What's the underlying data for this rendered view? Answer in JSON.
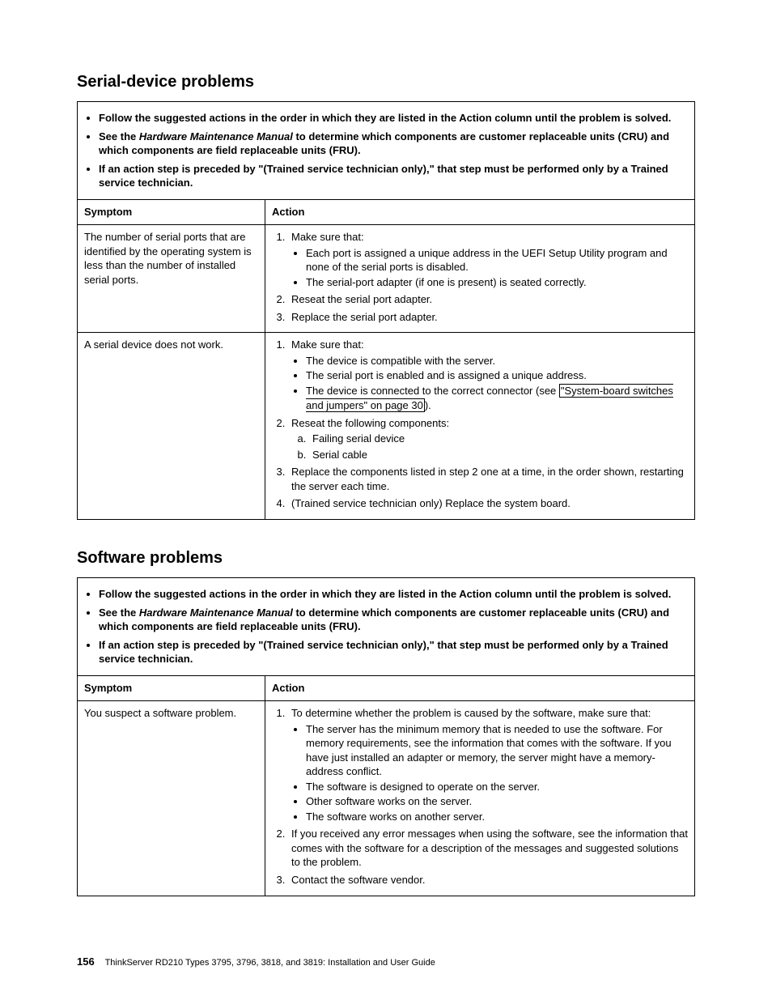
{
  "section1": {
    "title": "Serial-device problems",
    "notice": {
      "n1": "Follow the suggested actions in the order in which they are listed in the Action column until the problem is solved.",
      "n2_pre": "See the ",
      "n2_italic": "Hardware Maintenance Manual",
      "n2_post": " to determine which components are customer replaceable units (CRU) and which components are field replaceable units (FRU).",
      "n3": "If an action step is preceded by \"(Trained service technician only),\" that step must be performed only by a Trained service technician."
    },
    "headers": {
      "symptom": "Symptom",
      "action": "Action"
    },
    "row1": {
      "symptom": "The number of serial ports that are identified by the operating system is less than the number of installed serial ports.",
      "a1": "Make sure that:",
      "a1_b1": "Each port is assigned a unique address in the UEFI Setup Utility program and none of the serial ports is disabled.",
      "a1_b2": "The serial-port adapter (if one is present) is seated correctly.",
      "a2": "Reseat the serial port adapter.",
      "a3": "Replace the serial port adapter."
    },
    "row2": {
      "symptom": "A serial device does not work.",
      "a1": "Make sure that:",
      "a1_b1": "The device is compatible with the server.",
      "a1_b2": "The serial port is enabled and is assigned a unique address.",
      "a1_b3_pre": "The device is connected to the correct connector (see ",
      "a1_b3_link": "\"System-board switches and jumpers\" on page 30",
      "a1_b3_post": ").",
      "a2": "Reseat the following components:",
      "a2_a": "Failing serial device",
      "a2_b": "Serial cable",
      "a3": "Replace the components listed in step 2 one at a time, in the order shown, restarting the server each time.",
      "a4": "(Trained service technician only) Replace the system board."
    }
  },
  "section2": {
    "title": "Software problems",
    "notice": {
      "n1": "Follow the suggested actions in the order in which they are listed in the Action column until the problem is solved.",
      "n2_pre": "See the ",
      "n2_italic": "Hardware Maintenance Manual",
      "n2_post": " to determine which components are customer replaceable units (CRU) and which components are field replaceable units (FRU).",
      "n3": "If an action step is preceded by \"(Trained service technician only),\" that step must be performed only by a Trained service technician."
    },
    "headers": {
      "symptom": "Symptom",
      "action": "Action"
    },
    "row1": {
      "symptom": "You suspect a software problem.",
      "a1": "To determine whether the problem is caused by the software, make sure that:",
      "a1_b1": "The server has the minimum memory that is needed to use the software. For memory requirements, see the information that comes with the software. If you have just installed an adapter or memory, the server might have a memory-address conflict.",
      "a1_b2": "The software is designed to operate on the server.",
      "a1_b3": "Other software works on the server.",
      "a1_b4": "The software works on another server.",
      "a2": "If you received any error messages when using the software, see the information that comes with the software for a description of the messages and suggested solutions to the problem.",
      "a3": "Contact the software vendor."
    }
  },
  "footer": {
    "pagenum": "156",
    "text": "ThinkServer RD210 Types 3795, 3796, 3818, and 3819: Installation and User Guide"
  }
}
